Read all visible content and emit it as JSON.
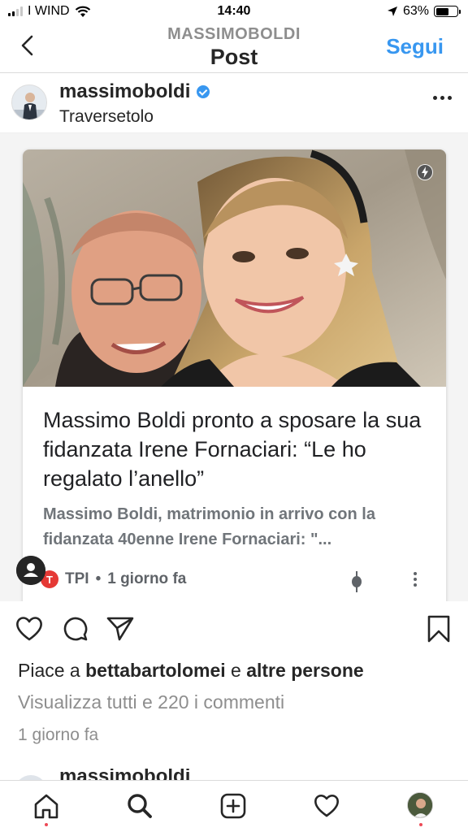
{
  "status_bar": {
    "carrier": "I WIND",
    "time": "14:40",
    "battery": "63%",
    "battery_level": 0.63
  },
  "nav": {
    "account": "MASSIMOBOLDI",
    "title": "Post",
    "follow_label": "Segui",
    "back_icon": "chevron-left-icon"
  },
  "post": {
    "username": "massimoboldi",
    "location": "Traversetolo",
    "verified": true
  },
  "card": {
    "headline": "Massimo Boldi pronto a sposare la sua fidanzata Irene Fornaciari: “Le ho regalato l’anello”",
    "snippet": "Massimo Boldi, matrimonio in arrivo con la fidanzata 40enne Irene Fornaciari: \"...",
    "source_logo": "T",
    "source": "TPI",
    "time": "1 giorno fa",
    "accent": "#e53935"
  },
  "engagement": {
    "likes_prefix": "Piace a",
    "liked_by": "bettabartolomei",
    "likes_joiner": "e",
    "others": "altre persone",
    "view_comments": "Visualizza tutti e 220 i commenti",
    "posted": "1 giorno fa"
  },
  "next_post": {
    "username": "massimoboldi"
  },
  "tabbar": {
    "items": [
      "home-icon",
      "search-icon",
      "add-post-icon",
      "activity-heart-icon",
      "profile-avatar"
    ]
  },
  "colors": {
    "link_blue": "#3897f0",
    "notification_red": "#ed4956"
  }
}
